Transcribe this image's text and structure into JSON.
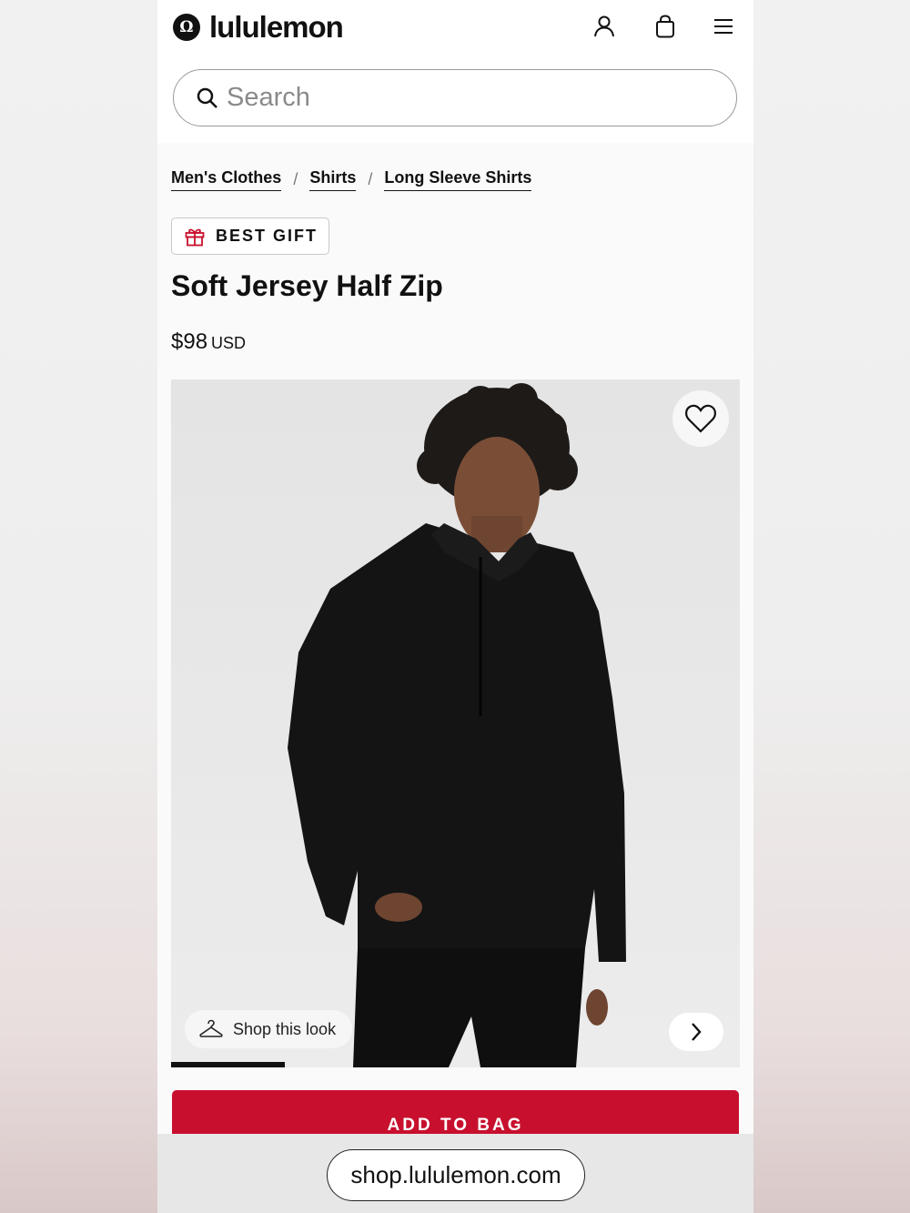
{
  "header": {
    "logo_mark": "Ω",
    "logo_text": "lululemon",
    "icons": [
      "account-icon",
      "bag-icon",
      "menu-icon"
    ]
  },
  "search": {
    "placeholder": "Search",
    "value": ""
  },
  "breadcrumb": [
    "Men's Clothes",
    "Shirts",
    "Long Sleeve Shirts"
  ],
  "badge": {
    "label": "BEST GIFT",
    "icon": "gift-icon"
  },
  "product": {
    "title": "Soft Jersey Half Zip",
    "price": "$98",
    "currency": "USD",
    "image_progress": 0.2
  },
  "gallery": {
    "shop_look_label": "Shop this look"
  },
  "cta": {
    "add_to_bag": "ADD TO BAG"
  },
  "browser": {
    "url": "shop.lululemon.com"
  },
  "colors": {
    "accent": "#c8102e",
    "text": "#111111"
  }
}
